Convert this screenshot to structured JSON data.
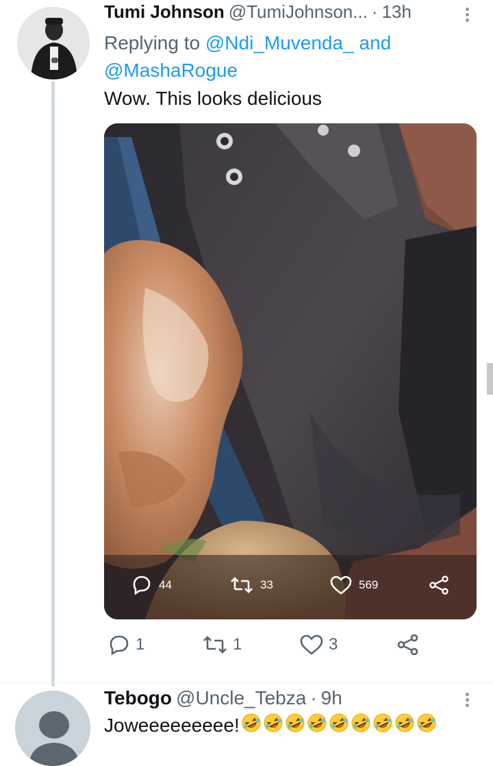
{
  "tweet1": {
    "name": "Tumi Johnson",
    "handle": "@TumiJohnson...",
    "separator": "·",
    "time": "13h",
    "reply_prefix": "Replying to",
    "reply_mention_1": "@Ndi_Muvenda_",
    "reply_and": "and",
    "reply_mention_2": "@MashaRogue",
    "text": "Wow. This looks delicious",
    "actions": {
      "replies": "1",
      "retweets": "1",
      "likes": "3"
    }
  },
  "media": {
    "actions": {
      "replies": "44",
      "retweets": "33",
      "likes": "569"
    }
  },
  "tweet2": {
    "name": "Tebogo",
    "handle": "@Uncle_Tebza",
    "separator": "·",
    "time": "9h",
    "text": "Joweeeeeeeee!",
    "emoji_count": 9
  },
  "icons": [
    "reply-icon",
    "retweet-icon",
    "like-icon",
    "share-icon",
    "more-icon",
    "rofl-emoji"
  ]
}
